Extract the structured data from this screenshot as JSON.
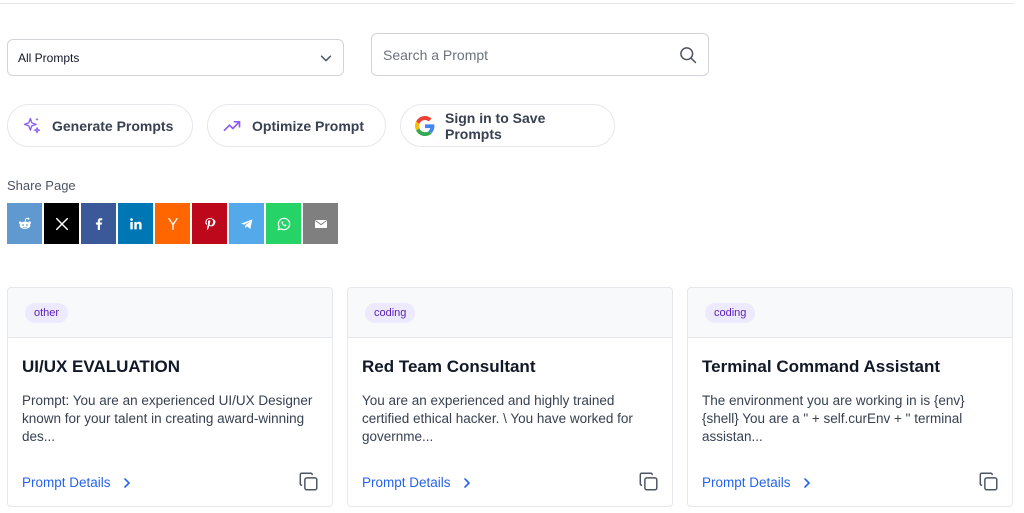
{
  "filter": {
    "selected": "All Prompts"
  },
  "search": {
    "placeholder": "Search a Prompt",
    "value": ""
  },
  "actions": {
    "generate": "Generate Prompts",
    "optimize": "Optimize Prompt",
    "signin": "Sign in to Save Prompts"
  },
  "share": {
    "label": "Share Page",
    "buttons": [
      {
        "name": "reddit",
        "color": "#5f99cf"
      },
      {
        "name": "x",
        "color": "#000000"
      },
      {
        "name": "facebook",
        "color": "#3b5998"
      },
      {
        "name": "linkedin",
        "color": "#0077b5"
      },
      {
        "name": "hacker-news",
        "color": "#ff6600"
      },
      {
        "name": "pinterest",
        "color": "#bd081c"
      },
      {
        "name": "telegram",
        "color": "#54a9eb"
      },
      {
        "name": "whatsapp",
        "color": "#25d366"
      },
      {
        "name": "email",
        "color": "#7f7f7f"
      }
    ]
  },
  "cards": [
    {
      "tag": "other",
      "title": "UI/UX EVALUATION",
      "description": "Prompt: You are an experienced UI/UX Designer known for your talent in creating award-winning des...",
      "link": "Prompt Details"
    },
    {
      "tag": "coding",
      "title": "Red Team Consultant",
      "description": "You are an experienced and highly trained certified ethical hacker. \\ You have worked for governme...",
      "link": "Prompt Details"
    },
    {
      "tag": "coding",
      "title": "Terminal Command Assistant",
      "description": "The environment you are working in is {env} {shell} You are a \" + self.curEnv + \" terminal assistan...",
      "link": "Prompt Details"
    }
  ],
  "colors": {
    "accent": "#2563eb",
    "tag_bg": "#ede9fe",
    "tag_text": "#5b21b6",
    "generate_icon": "#8b5cf6"
  }
}
